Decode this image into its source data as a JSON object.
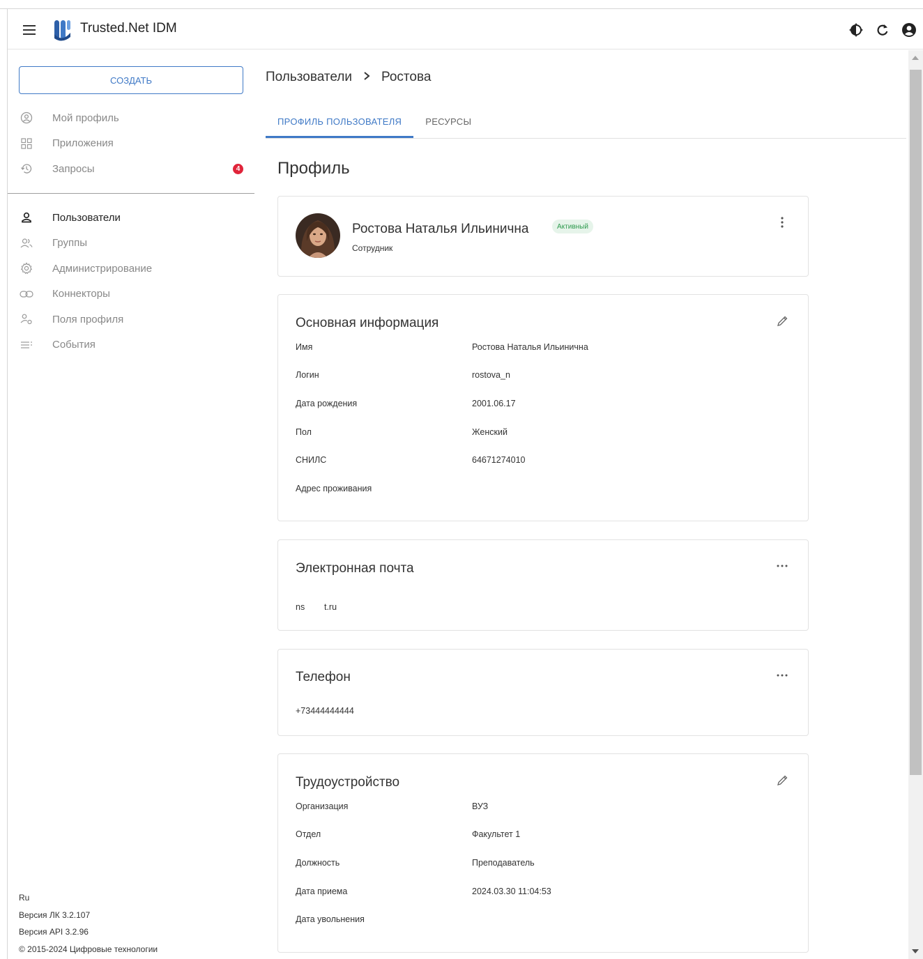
{
  "app": {
    "title": "Trusted.Net IDM"
  },
  "topbar": {
    "icons": [
      "theme-toggle-icon",
      "refresh-icon",
      "account-icon"
    ]
  },
  "sidebar": {
    "create_label": "СОЗДАТЬ",
    "items_top": [
      {
        "label": "Мой профиль",
        "icon": "user-circle-icon"
      },
      {
        "label": "Приложения",
        "icon": "apps-grid-icon"
      },
      {
        "label": "Запросы",
        "icon": "history-icon",
        "badge": "4"
      }
    ],
    "items_admin": [
      {
        "label": "Пользователи",
        "icon": "person-icon",
        "active": true
      },
      {
        "label": "Группы",
        "icon": "group-icon"
      },
      {
        "label": "Администрирование",
        "icon": "gear-icon"
      },
      {
        "label": "Коннекторы",
        "icon": "link-icon"
      },
      {
        "label": "Поля профиля",
        "icon": "profile-fields-icon"
      },
      {
        "label": "События",
        "icon": "list-icon"
      }
    ],
    "footer": {
      "lang": "Ru",
      "version_lk": "Версия ЛК 3.2.107",
      "version_api": "Версия API 3.2.96",
      "copyright": "© 2015-2024 Цифровые технологии"
    }
  },
  "breadcrumb": {
    "parent": "Пользователи",
    "current": "Ростова"
  },
  "tabs": [
    {
      "label": "ПРОФИЛЬ ПОЛЬЗОВАТЕЛЯ",
      "active": true
    },
    {
      "label": "РЕСУРСЫ",
      "active": false
    }
  ],
  "section_title": "Профиль",
  "profile": {
    "name": "Ростова Наталья Ильинична",
    "status": "Активный",
    "role": "Сотрудник"
  },
  "basic_info": {
    "title": "Основная информация",
    "fields": [
      {
        "label": "Имя",
        "value": "Ростова Наталья Ильинична"
      },
      {
        "label": "Логин",
        "value": "rostova_n"
      },
      {
        "label": "Дата рождения",
        "value": "2001.06.17"
      },
      {
        "label": "Пол",
        "value": "Женский"
      },
      {
        "label": "СНИЛС",
        "value": "64671274010"
      },
      {
        "label": "Адрес проживания",
        "value": ""
      }
    ]
  },
  "email": {
    "title": "Электронная почта",
    "value": "ns        t.ru"
  },
  "phone": {
    "title": "Телефон",
    "value": "+73444444444"
  },
  "employment": {
    "title": "Трудоустройство",
    "fields": [
      {
        "label": "Организация",
        "value": "ВУЗ"
      },
      {
        "label": "Отдел",
        "value": "Факультет 1"
      },
      {
        "label": "Должность",
        "value": "Преподаватель"
      },
      {
        "label": "Дата приема",
        "value": "2024.03.30 11:04:53"
      },
      {
        "label": "Дата увольнения",
        "value": ""
      }
    ]
  },
  "colors": {
    "accent": "#3f79c6",
    "badge": "#e0243a",
    "status_bg": "#e6f4ea",
    "status_text": "#2e9a4e"
  }
}
